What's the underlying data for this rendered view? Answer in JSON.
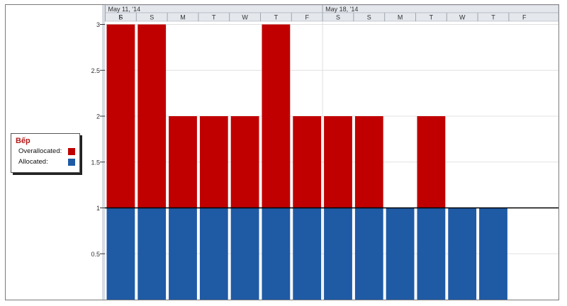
{
  "timescale": {
    "weeks": [
      "May 11, '14",
      "May 18, '14"
    ],
    "days": [
      "F",
      "S",
      "S",
      "M",
      "T",
      "W",
      "T",
      "F",
      "S",
      "S",
      "M",
      "T",
      "W",
      "T",
      "F"
    ]
  },
  "legend": {
    "resource": "Bếp",
    "overallocated_label": "Overallocated:",
    "allocated_label": "Allocated:"
  },
  "colors": {
    "overallocated": "#c00000",
    "allocated": "#1f5aa5",
    "header_bg": "#e4e7ec",
    "grid": "#e0e0e0"
  },
  "chart_data": {
    "type": "bar",
    "categories": [
      "F",
      "S",
      "S",
      "M",
      "T",
      "W",
      "T",
      "F",
      "S",
      "S",
      "M",
      "T",
      "W",
      "T",
      "F"
    ],
    "series": [
      {
        "name": "Allocated:",
        "values": [
          0,
          1,
          1,
          1,
          1,
          1,
          1,
          1,
          1,
          1,
          1,
          1,
          1,
          1,
          0
        ]
      },
      {
        "name": "Overallocated:",
        "values": [
          0,
          2,
          2,
          1,
          1,
          1,
          2,
          1,
          1,
          1,
          0,
          1,
          0,
          0,
          0
        ]
      }
    ],
    "yticks": [
      "0.5",
      "1",
      "1.5",
      "2",
      "2.5",
      "3"
    ],
    "ylim": [
      0,
      3.2
    ],
    "max_units_line": 1
  }
}
